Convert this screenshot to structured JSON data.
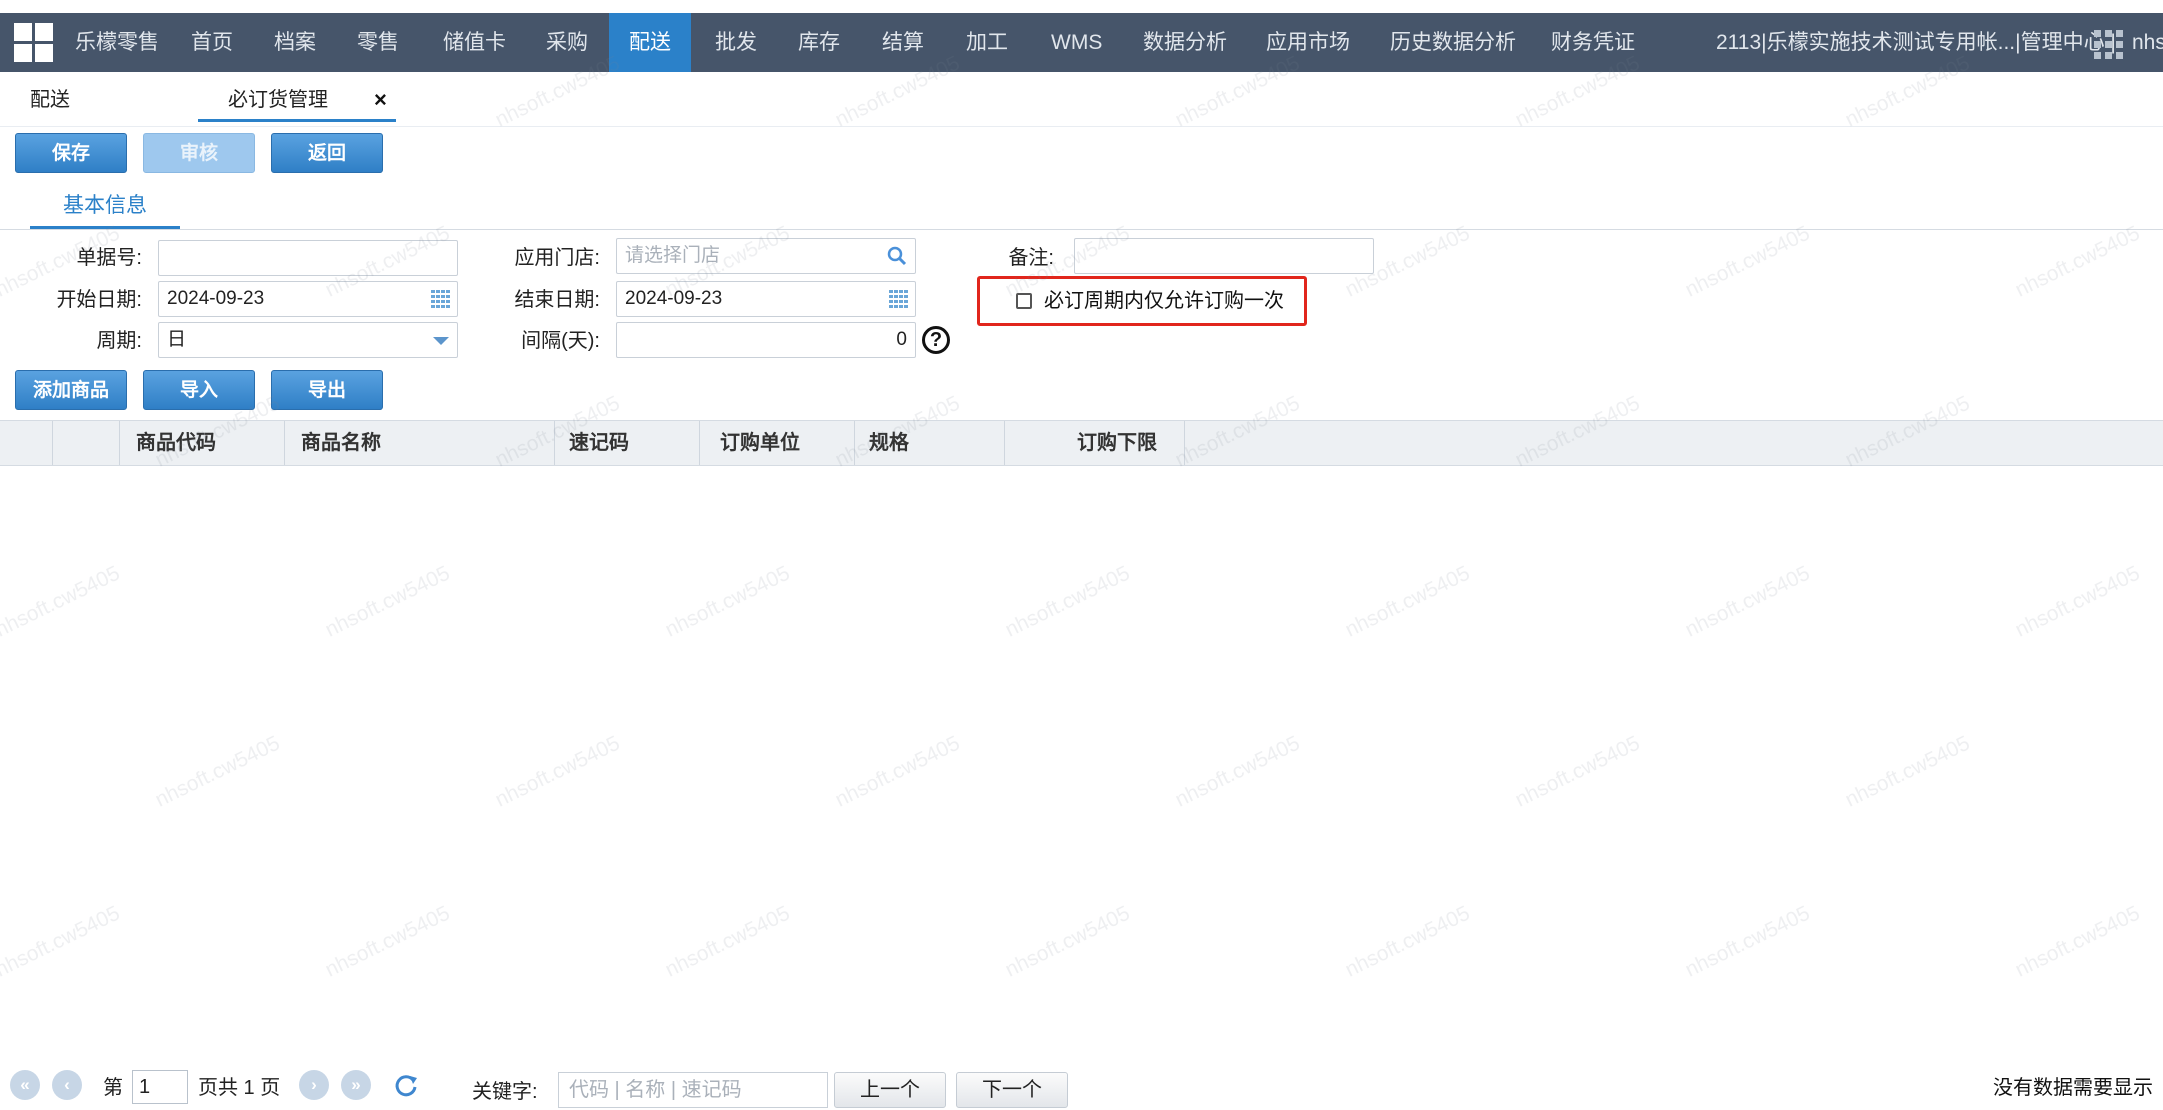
{
  "topnav": {
    "items": [
      "乐檬零售",
      "首页",
      "档案",
      "零售",
      "储值卡",
      "采购",
      "配送",
      "批发",
      "库存",
      "结算",
      "加工",
      "WMS",
      "数据分析",
      "应用市场",
      "历史数据分析",
      "财务凭证"
    ],
    "active": "配送",
    "account": "2113|乐檬实施技术测试专用帐...|管理中心 |",
    "user_fragment": "nhs"
  },
  "tabs": [
    {
      "label": "配送"
    },
    {
      "label": "必订货管理",
      "close": "×"
    }
  ],
  "toolbar": {
    "save": "保存",
    "audit": "审核",
    "back": "返回"
  },
  "subtab": "基本信息",
  "form": {
    "doc_no_label": "单据号:",
    "doc_no_value": "",
    "store_label": "应用门店:",
    "store_placeholder": "请选择门店",
    "remark_label": "备注:",
    "remark_value": "",
    "start_label": "开始日期:",
    "start_value": "2024-09-23",
    "end_label": "结束日期:",
    "end_value": "2024-09-23",
    "period_label": "周期:",
    "period_value": "日",
    "interval_label": "间隔(天):",
    "interval_value": "0",
    "help": "?",
    "once_only_label": "必订周期内仅允许订购一次",
    "once_only_checked": false
  },
  "actions": {
    "add": "添加商品",
    "import": "导入",
    "export": "导出"
  },
  "table": {
    "columns": [
      "",
      "",
      "商品代码",
      "商品名称",
      "速记码",
      "订购单位",
      "规格",
      "订购下限"
    ],
    "rows": []
  },
  "pager": {
    "page_prefix": "第",
    "page_value": "1",
    "page_suffix": "页共 1 页",
    "keyword_label": "关键字:",
    "keyword_placeholder": "代码 | 名称 | 速记码",
    "prev": "上一个",
    "next": "下一个",
    "status": "没有数据需要显示"
  },
  "watermark": "nhsoft.cw5405",
  "colors": {
    "nav_bg": "#46556a",
    "accent": "#2b81c9",
    "highlight_box": "#e1261c"
  }
}
